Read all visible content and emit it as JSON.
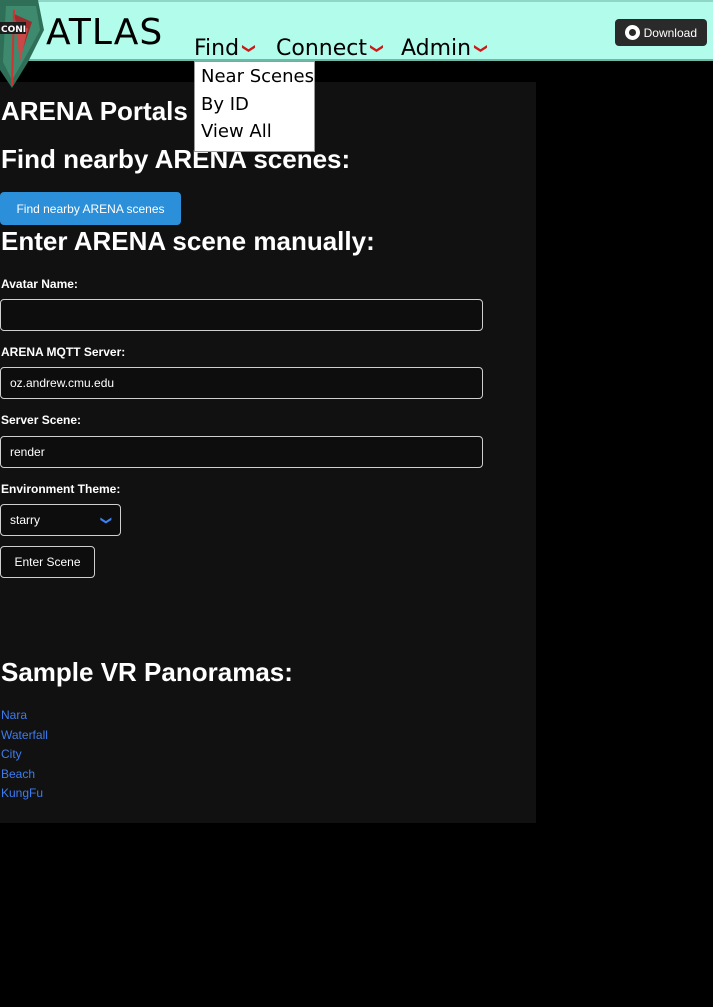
{
  "nav": {
    "brand": "ATLAS",
    "logo_text": "CONI",
    "find_label": "Find",
    "connect_label": "Connect",
    "admin_label": "Admin",
    "chevron_glyph": "❯",
    "download_label": "Download",
    "accent_color": "#b2fcec"
  },
  "find_menu": {
    "items": [
      "Near Scenes",
      "By ID",
      "View All"
    ]
  },
  "main": {
    "portals_heading": "ARENA Portals",
    "nearby_heading": "Find nearby ARENA scenes:",
    "nearby_button": "Find nearby ARENA scenes",
    "manual_heading": "Enter ARENA scene manually:",
    "avatar_label": "Avatar Name:",
    "avatar_value": "",
    "mqtt_label": "ARENA MQTT Server:",
    "mqtt_value": "oz.andrew.cmu.edu",
    "scene_label": "Server Scene:",
    "scene_value": "render",
    "theme_label": "Environment Theme:",
    "theme_value": "starry",
    "enter_button": "Enter Scene",
    "panoramas_heading": "Sample VR Panoramas:",
    "panoramas": [
      "Nara",
      "Waterfall",
      "City",
      "Beach",
      "KungFu"
    ]
  }
}
